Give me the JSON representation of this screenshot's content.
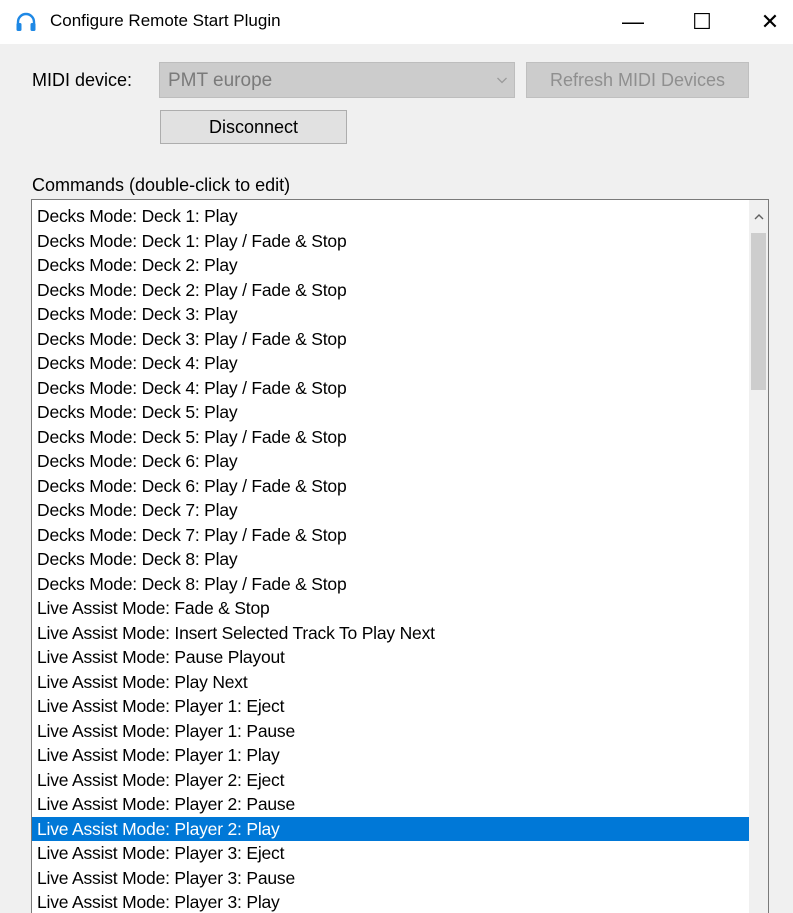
{
  "window": {
    "title": "Configure Remote Start Plugin",
    "minimize": "—",
    "maximize": "☐",
    "close": "✕"
  },
  "midi": {
    "label": "MIDI device:",
    "selected_device": "PMT europe",
    "refresh_label": "Refresh MIDI Devices",
    "disconnect_label": "Disconnect"
  },
  "commands": {
    "label": "Commands (double-click to edit)",
    "selected_index": 25,
    "items": [
      "Decks Mode: Deck 1: Play",
      "Decks Mode: Deck 1: Play / Fade & Stop",
      "Decks Mode: Deck 2: Play",
      "Decks Mode: Deck 2: Play / Fade & Stop",
      "Decks Mode: Deck 3: Play",
      "Decks Mode: Deck 3: Play / Fade & Stop",
      "Decks Mode: Deck 4: Play",
      "Decks Mode: Deck 4: Play / Fade & Stop",
      "Decks Mode: Deck 5: Play",
      "Decks Mode: Deck 5: Play / Fade & Stop",
      "Decks Mode: Deck 6: Play",
      "Decks Mode: Deck 6: Play / Fade & Stop",
      "Decks Mode: Deck 7: Play",
      "Decks Mode: Deck 7: Play / Fade & Stop",
      "Decks Mode: Deck 8: Play",
      "Decks Mode: Deck 8: Play / Fade & Stop",
      "Live Assist Mode: Fade & Stop",
      "Live Assist Mode: Insert Selected Track To Play Next",
      "Live Assist Mode: Pause Playout",
      "Live Assist Mode: Play Next",
      "Live Assist Mode: Player 1: Eject",
      "Live Assist Mode: Player 1: Pause",
      "Live Assist Mode: Player 1: Play",
      "Live Assist Mode: Player 2: Eject",
      "Live Assist Mode: Player 2: Pause",
      "Live Assist Mode: Player 2: Play",
      "Live Assist Mode: Player 3: Eject",
      "Live Assist Mode: Player 3: Pause",
      "Live Assist Mode: Player 3: Play"
    ]
  },
  "colors": {
    "selection": "#0078d7",
    "icon": "#1e88e5"
  },
  "icons": {
    "app": "headphones-icon",
    "dropdown": "chevron-down-icon",
    "scroll_up": "chevron-up-icon"
  }
}
